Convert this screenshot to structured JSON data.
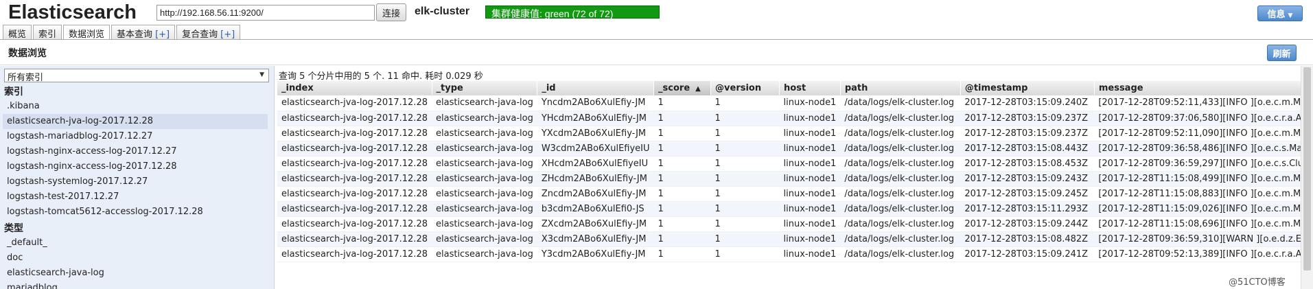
{
  "header": {
    "logo": "Elasticsearch",
    "url_value": "http://192.168.56.11:9200/",
    "connect_label": "连接",
    "cluster_name": "elk-cluster",
    "health": "集群健康值: green (72 of 72)",
    "health_color": "#119911",
    "info_label": "信息"
  },
  "tabs": [
    {
      "label": "概览",
      "plus": ""
    },
    {
      "label": "索引",
      "plus": ""
    },
    {
      "label": "数据浏览",
      "plus": ""
    },
    {
      "label": "基本查询",
      "plus": "[+]"
    },
    {
      "label": "复合查询",
      "plus": "[+]"
    }
  ],
  "section": {
    "title": "数据浏览",
    "refresh_label": "刷新"
  },
  "sidebar": {
    "select_value": "所有索引",
    "indices_heading": "索引",
    "indices": [
      ".kibana",
      "elasticsearch-jva-log-2017.12.28",
      "logstash-mariadblog-2017.12.27",
      "logstash-nginx-access-log-2017.12.27",
      "logstash-nginx-access-log-2017.12.28",
      "logstash-systemlog-2017.12.27",
      "logstash-test-2017.12.27",
      "logstash-tomcat5612-accesslog-2017.12.28"
    ],
    "types_heading": "类型",
    "types": [
      "_default_",
      "doc",
      "elasticsearch-java-log",
      "mariadblog"
    ]
  },
  "main": {
    "query_info": "查询 5 个分片中用的 5 个. 11 命中. 耗时 0.029 秒",
    "columns": [
      "_index",
      "_type",
      "_id",
      "_score",
      "@version",
      "host",
      "path",
      "@timestamp",
      "message"
    ],
    "rows": [
      [
        "elasticsearch-jva-log-2017.12.28",
        "elasticsearch-java-log",
        "Yncdm2ABo6XulEfiy-JM",
        "1",
        "1",
        "linux-node1",
        "/data/logs/elk-cluster.log",
        "2017-12-28T03:15:09.240Z",
        "[2017-12-28T09:52:11,433][INFO ][o.e.c.m.M"
      ],
      [
        "elasticsearch-jva-log-2017.12.28",
        "elasticsearch-java-log",
        "YHcdm2ABo6XulEfiy-JM",
        "1",
        "1",
        "linux-node1",
        "/data/logs/elk-cluster.log",
        "2017-12-28T03:15:09.237Z",
        "[2017-12-28T09:37:06,580][INFO ][o.e.c.r.a.A"
      ],
      [
        "elasticsearch-jva-log-2017.12.28",
        "elasticsearch-java-log",
        "YXcdm2ABo6XulEfiy-JM",
        "1",
        "1",
        "linux-node1",
        "/data/logs/elk-cluster.log",
        "2017-12-28T03:15:09.237Z",
        "[2017-12-28T09:52:11,090][INFO ][o.e.c.m.M"
      ],
      [
        "elasticsearch-jva-log-2017.12.28",
        "elasticsearch-java-log",
        "W3cdm2ABo6XulEfiyeIU",
        "1",
        "1",
        "linux-node1",
        "/data/logs/elk-cluster.log",
        "2017-12-28T03:15:08.443Z",
        "[2017-12-28T09:36:58,486][INFO ][o.e.c.s.Ma"
      ],
      [
        "elasticsearch-jva-log-2017.12.28",
        "elasticsearch-java-log",
        "XHcdm2ABo6XulEfiyeIU",
        "1",
        "1",
        "linux-node1",
        "/data/logs/elk-cluster.log",
        "2017-12-28T03:15:08.453Z",
        "[2017-12-28T09:36:59,297][INFO ][o.e.c.s.Clu"
      ],
      [
        "elasticsearch-jva-log-2017.12.28",
        "elasticsearch-java-log",
        "ZHcdm2ABo6XulEfiy-JM",
        "1",
        "1",
        "linux-node1",
        "/data/logs/elk-cluster.log",
        "2017-12-28T03:15:09.243Z",
        "[2017-12-28T11:15:08,499][INFO ][o.e.c.m.M"
      ],
      [
        "elasticsearch-jva-log-2017.12.28",
        "elasticsearch-java-log",
        "Zncdm2ABo6XulEfiy-JM",
        "1",
        "1",
        "linux-node1",
        "/data/logs/elk-cluster.log",
        "2017-12-28T03:15:09.245Z",
        "[2017-12-28T11:15:08,883][INFO ][o.e.c.m.M"
      ],
      [
        "elasticsearch-jva-log-2017.12.28",
        "elasticsearch-java-log",
        "b3cdm2ABo6XulEfi0-JS",
        "1",
        "1",
        "linux-node1",
        "/data/logs/elk-cluster.log",
        "2017-12-28T03:15:11.293Z",
        "[2017-12-28T11:15:09,026][INFO ][o.e.c.m.M"
      ],
      [
        "elasticsearch-jva-log-2017.12.28",
        "elasticsearch-java-log",
        "ZXcdm2ABo6XulEfiy-JM",
        "1",
        "1",
        "linux-node1",
        "/data/logs/elk-cluster.log",
        "2017-12-28T03:15:09.244Z",
        "[2017-12-28T11:15:08,696][INFO ][o.e.c.m.M"
      ],
      [
        "elasticsearch-jva-log-2017.12.28",
        "elasticsearch-java-log",
        "X3cdm2ABo6XulEfiy-JM",
        "1",
        "1",
        "linux-node1",
        "/data/logs/elk-cluster.log",
        "2017-12-28T03:15:08.482Z",
        "[2017-12-28T09:36:59,310][WARN ][o.e.d.z.El"
      ],
      [
        "elasticsearch-jva-log-2017.12.28",
        "elasticsearch-java-log",
        "Y3cdm2ABo6XulEfiy-JM",
        "1",
        "1",
        "linux-node1",
        "/data/logs/elk-cluster.log",
        "2017-12-28T03:15:09.241Z",
        "[2017-12-28T09:52:13,389][INFO ][o.e.c.r.a.A"
      ]
    ]
  },
  "watermark": "@51CTO博客"
}
